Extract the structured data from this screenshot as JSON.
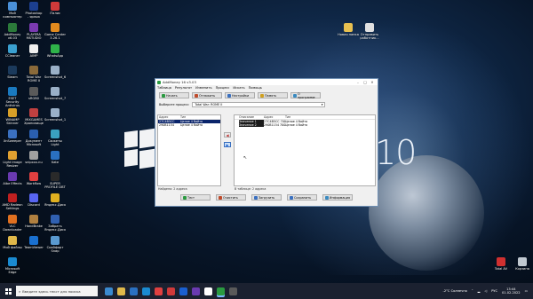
{
  "desktop": {
    "icons": [
      {
        "label": "Мой\nкомпьютер",
        "color": "#4a90d9"
      },
      {
        "label": "Photoshop\n- ярлык",
        "color": "#1c3f8f"
      },
      {
        "label": "iТалис",
        "color": "#d03a3a"
      },
      {
        "label": "AddMoney\nv6.03",
        "color": "#2b7a3a"
      },
      {
        "label": "PLAYERA\nMSTUDIO",
        "color": "#7a3ab0"
      },
      {
        "label": "Game Center\n3.26.1",
        "color": "#e28a1e"
      },
      {
        "label": "CCleaner",
        "color": "#3aa0d0"
      },
      {
        "label": "AIMP",
        "color": "#f0f0f0"
      },
      {
        "label": "WhatsApp",
        "color": "#2fb34a"
      },
      {
        "label": "Steam",
        "color": "#1b3a5c"
      },
      {
        "label": "Total War\nROME II",
        "color": "#8a6a3a"
      },
      {
        "label": "Screenshot_6",
        "color": "#9ab0c8"
      },
      {
        "label": "ESET Security\nAntivirus",
        "color": "#1a7ac0"
      },
      {
        "label": "sRGB0",
        "color": "#5a5a5a"
      },
      {
        "label": "Screenshot_7",
        "color": "#9ab0c8"
      },
      {
        "label": "WINAMP\nSkinner",
        "color": "#d8a028"
      },
      {
        "label": "MIXGAMES\nХранилище",
        "color": "#c04040"
      },
      {
        "label": "Screenshot_1",
        "color": "#9ab0c8"
      },
      {
        "label": "XnSweeper",
        "color": "#3a70c0"
      },
      {
        "label": "Документ\nMicrosoft",
        "color": "#2a5fb0"
      },
      {
        "label": "Сюжеты\nLight",
        "color": "#3aa0c0"
      },
      {
        "label": "Light Image\nResizer",
        "color": "#e0a030"
      },
      {
        "label": "snipxxx.nu",
        "color": "#a0a0a0"
      },
      {
        "label": "Kate",
        "color": "#2a70c0"
      },
      {
        "label": "Albe Effects",
        "color": "#6a3ab0"
      },
      {
        "label": "Workflow",
        "color": "#e04040"
      },
      {
        "label": "SUPER\nPROFILE DBT",
        "color": "#2a2a2a"
      },
      {
        "label": "AMD Radeon\nSettings",
        "color": "#c02020"
      },
      {
        "label": "Discord",
        "color": "#5865f2"
      },
      {
        "label": "Яндекс.Диск",
        "color": "#e0b020"
      },
      {
        "label": "VLC\nDownloader",
        "color": "#e07020"
      },
      {
        "label": "HandBrake",
        "color": "#b08040"
      },
      {
        "label": "Забрать\nЯндекс.Диск",
        "color": "#3060b0"
      },
      {
        "label": "Мой файлы",
        "color": "#e0b84a"
      },
      {
        "label": "TeamViewer",
        "color": "#1a70d0"
      },
      {
        "label": "Скайфорт\nSnap",
        "color": "#5a9ad0"
      },
      {
        "label": "Microsoft\nEdge",
        "color": "#1a8ad0"
      }
    ],
    "right_icons": [
      {
        "label": "Новая папка",
        "color": "#e8c050"
      },
      {
        "label": "Отправить\nработник...",
        "color": "#e0e0e0"
      },
      {
        "label": "Корзина",
        "color": "#c0c8d0"
      },
      {
        "label": "Total AV",
        "color": "#d03030"
      }
    ],
    "wallpaper_number": "10"
  },
  "window": {
    "title": "AddMoney 16 v3.03",
    "menu": [
      "Таблица",
      "Результат",
      "Изменить",
      "Процесс",
      "Искать",
      "Помощь"
    ],
    "toolbar_top": [
      {
        "label": "Начать",
        "color": "#2a9a40"
      },
      {
        "label": "Отлажить",
        "color": "#c04a2a"
      },
      {
        "label": "Настройки",
        "color": "#3a70c0"
      },
      {
        "label": "Память",
        "color": "#d0a020"
      },
      {
        "label": "О программе",
        "color": "#3a8ac0"
      }
    ],
    "select_label": "Выберите процесс:",
    "select_value": "Total War: ROME II",
    "left_list": {
      "headers": [
        "Адрес",
        "Тип"
      ],
      "rows": [
        {
          "addr": "27C4B5CC",
          "type": "Целое 4 байта",
          "selected": true
        },
        {
          "addr": "290B1154",
          "type": "Целое 4 байта",
          "selected": false
        }
      ]
    },
    "right_list": {
      "headers": [
        "",
        "Описание",
        "Адрес",
        "Тип"
      ],
      "rows": [
        {
          "desc": "Значение 1",
          "addr": "27C4B5CC 700",
          "type": "Целое 4 байта",
          "selected": true
        },
        {
          "desc": "Значение 2",
          "addr": "290B1154 700",
          "type": "Целое 4 байта",
          "selected": false
        }
      ]
    },
    "status_left": "Найдено: 2 адреса",
    "status_right": "В таблице: 2 адреса",
    "toolbar_bottom": [
      {
        "label": "Тест",
        "color": "#2a9a40"
      },
      {
        "label": "Очистить",
        "color": "#c04a2a"
      },
      {
        "label": "Загрузить",
        "color": "#3a70c0"
      },
      {
        "label": "Сохранить",
        "color": "#3a70c0"
      },
      {
        "label": "Информация",
        "color": "#3a8ac0"
      }
    ]
  },
  "taskbar": {
    "search_placeholder": "Введите здесь текст для поиска",
    "apps": [
      "#3a8ad0",
      "#e0b84a",
      "#2a70c0",
      "#1a8ad0",
      "#e04040",
      "#d03a3a",
      "#1a5fd0",
      "#6a3ab0",
      "#ffffff",
      "#2a9a40",
      "#5a5a5a"
    ],
    "active_app_index": 9,
    "weather": "-2°C Солнечно",
    "lang": "РУС",
    "time": "13:44",
    "date": "01.02.2022"
  }
}
